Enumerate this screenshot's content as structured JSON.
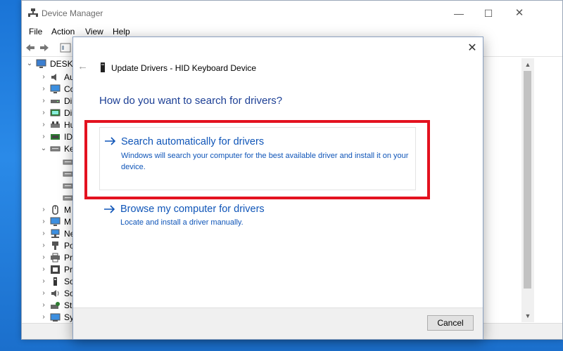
{
  "device_manager": {
    "title": "Device Manager",
    "window_controls": {
      "minimize": "—",
      "maximize": "☐",
      "close": "✕"
    },
    "menu": [
      "File",
      "Action",
      "View",
      "Help"
    ],
    "tree": {
      "root_label": "DESKT",
      "rows": [
        {
          "label": "Au",
          "icon": "audio-icon"
        },
        {
          "label": "Co",
          "icon": "computer-icon"
        },
        {
          "label": "Di",
          "icon": "disk-drive-icon"
        },
        {
          "label": "Di",
          "icon": "display-adapter-icon"
        },
        {
          "label": "Hu",
          "icon": "hid-icon"
        },
        {
          "label": "ID",
          "icon": "ide-controller-icon"
        },
        {
          "label": "Ke",
          "icon": "keyboard-icon"
        },
        {
          "label": "",
          "icon": "keyboard-device-icon"
        },
        {
          "label": "",
          "icon": "keyboard-device-icon"
        },
        {
          "label": "",
          "icon": "keyboard-device-icon"
        },
        {
          "label": "",
          "icon": "keyboard-device-icon"
        },
        {
          "label": "M",
          "icon": "mouse-icon"
        },
        {
          "label": "M",
          "icon": "monitor-icon"
        },
        {
          "label": "Ne",
          "icon": "network-adapter-icon"
        },
        {
          "label": "Po",
          "icon": "ports-icon"
        },
        {
          "label": "Pr",
          "icon": "printer-icon"
        },
        {
          "label": "Pr",
          "icon": "processor-icon"
        },
        {
          "label": "So",
          "icon": "software-device-icon"
        },
        {
          "label": "So",
          "icon": "sound-icon"
        },
        {
          "label": "St",
          "icon": "storage-controller-icon"
        },
        {
          "label": "Sy",
          "icon": "system-devices-icon"
        }
      ]
    }
  },
  "dialog": {
    "title": "Update Drivers - HID Keyboard Device",
    "back_icon": "←",
    "close_icon": "✕",
    "heading": "How do you want to search for drivers?",
    "options": [
      {
        "title": "Search automatically for drivers",
        "description": "Windows will search your computer for the best available driver and install it on your device."
      },
      {
        "title": "Browse my computer for drivers",
        "description": "Locate and install a driver manually."
      }
    ],
    "cancel_label": "Cancel"
  },
  "colors": {
    "link_blue": "#0f55b8",
    "heading_blue": "#1c3f95",
    "highlight_red": "#e3121f",
    "desktop_blue": "#1a74d6"
  }
}
